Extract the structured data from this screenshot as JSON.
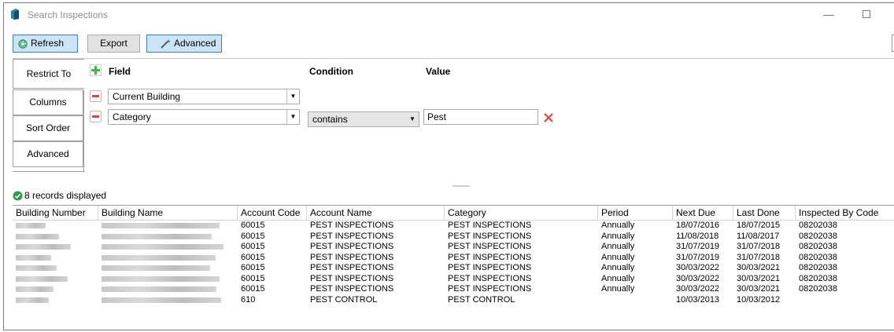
{
  "window": {
    "title": "Search Inspections"
  },
  "toolbar": {
    "refresh_label": "Refresh",
    "export_label": "Export",
    "advanced_label": "Advanced"
  },
  "tabs": [
    {
      "label": "Restrict To",
      "selected": true
    },
    {
      "label": "Columns"
    },
    {
      "label": "Sort Order"
    },
    {
      "label": "Advanced"
    }
  ],
  "restrict": {
    "field_header": "Field",
    "condition_header": "Condition",
    "value_header": "Value",
    "rows": [
      {
        "field": "Current Building"
      },
      {
        "field": "Category",
        "condition": "contains",
        "value": "Pest"
      }
    ]
  },
  "status": {
    "text": "8 records displayed"
  },
  "grid": {
    "columns": [
      "Building Number",
      "Building Name",
      "Account Code",
      "Account Name",
      "Category",
      "Period",
      "Next Due",
      "Last Done",
      "Inspected By Code"
    ],
    "rows": [
      [
        "",
        "",
        "60015",
        "PEST INSPECTIONS",
        "PEST INSPECTIONS",
        "Annually",
        "18/07/2016",
        "18/07/2015",
        "08202038"
      ],
      [
        "",
        "",
        "60015",
        "PEST INSPECTIONS",
        "PEST INSPECTIONS",
        "Annually",
        "11/08/2018",
        "11/08/2017",
        "08202038"
      ],
      [
        "",
        "",
        "60015",
        "PEST INSPECTIONS",
        "PEST INSPECTIONS",
        "Annually",
        "31/07/2019",
        "31/07/2018",
        "08202038"
      ],
      [
        "",
        "",
        "60015",
        "PEST INSPECTIONS",
        "PEST INSPECTIONS",
        "Annually",
        "31/07/2019",
        "31/07/2018",
        "08202038"
      ],
      [
        "",
        "",
        "60015",
        "PEST INSPECTIONS",
        "PEST INSPECTIONS",
        "Annually",
        "30/03/2022",
        "30/03/2021",
        "08202038"
      ],
      [
        "",
        "",
        "60015",
        "PEST INSPECTIONS",
        "PEST INSPECTIONS",
        "Annually",
        "30/03/2022",
        "30/03/2021",
        "08202038"
      ],
      [
        "",
        "",
        "60015",
        "PEST INSPECTIONS",
        "PEST INSPECTIONS",
        "Annually",
        "30/03/2022",
        "30/03/2021",
        "08202038"
      ],
      [
        "",
        "",
        "610",
        "PEST CONTROL",
        "PEST CONTROL",
        "",
        "10/03/2013",
        "10/03/2012",
        ""
      ]
    ]
  },
  "colors": {
    "accent": "#cce4f7",
    "accent_border": "#3c7fb1",
    "add": "#4caf50",
    "remove": "#e1403b",
    "ok": "#2e9c4a"
  }
}
